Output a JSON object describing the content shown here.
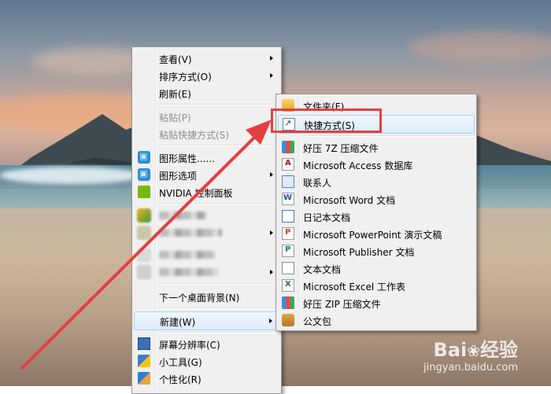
{
  "main_menu": {
    "items": [
      {
        "label": "查看(V)",
        "submenu": true
      },
      {
        "label": "排序方式(O)",
        "submenu": true
      },
      {
        "label": "刷新(E)"
      },
      {
        "label": "粘贴(P)",
        "disabled": true
      },
      {
        "label": "粘贴快捷方式(S)",
        "disabled": true
      },
      {
        "label": "图形属性......",
        "icon": "graphics-properties-icon"
      },
      {
        "label": "图形选项",
        "icon": "graphics-options-icon",
        "submenu": true
      },
      {
        "label": "NVIDIA 控制面板",
        "icon": "nvidia-icon"
      },
      {
        "label": "下一个桌面背景(N)"
      },
      {
        "label": "新建(W)",
        "submenu": true,
        "highlighted": true
      },
      {
        "label": "屏幕分辨率(C)",
        "icon": "monitor-icon"
      },
      {
        "label": "小工具(G)",
        "icon": "gadget-icon"
      },
      {
        "label": "个性化(R)",
        "icon": "personalize-icon"
      }
    ]
  },
  "new_submenu": {
    "items": [
      {
        "label": "文件夹(F)",
        "icon": "folder-icon"
      },
      {
        "label": "快捷方式(S)",
        "icon": "shortcut-icon",
        "highlighted": true
      },
      {
        "label": "好压 7Z 压缩文件",
        "icon": "archive-icon"
      },
      {
        "label": "Microsoft Access 数据库",
        "icon": "access-icon"
      },
      {
        "label": "联系人",
        "icon": "contact-icon"
      },
      {
        "label": "Microsoft Word 文档",
        "icon": "word-icon"
      },
      {
        "label": "日记本文档",
        "icon": "journal-icon"
      },
      {
        "label": "Microsoft PowerPoint 演示文稿",
        "icon": "powerpoint-icon"
      },
      {
        "label": "Microsoft Publisher 文档",
        "icon": "publisher-icon"
      },
      {
        "label": "文本文档",
        "icon": "text-document-icon"
      },
      {
        "label": "Microsoft Excel 工作表",
        "icon": "excel-icon"
      },
      {
        "label": "好压 ZIP 压缩文件",
        "icon": "archive-icon"
      },
      {
        "label": "公文包",
        "icon": "briefcase-icon"
      }
    ]
  },
  "watermark": {
    "logo": "Bai",
    "logo_suffix": "经验",
    "url": "jingyan.baidu.com"
  },
  "colors": {
    "annotation_red": "#e43f3f",
    "menu_bg": "#f0f0f0",
    "highlight_border": "#a8d0f4"
  }
}
